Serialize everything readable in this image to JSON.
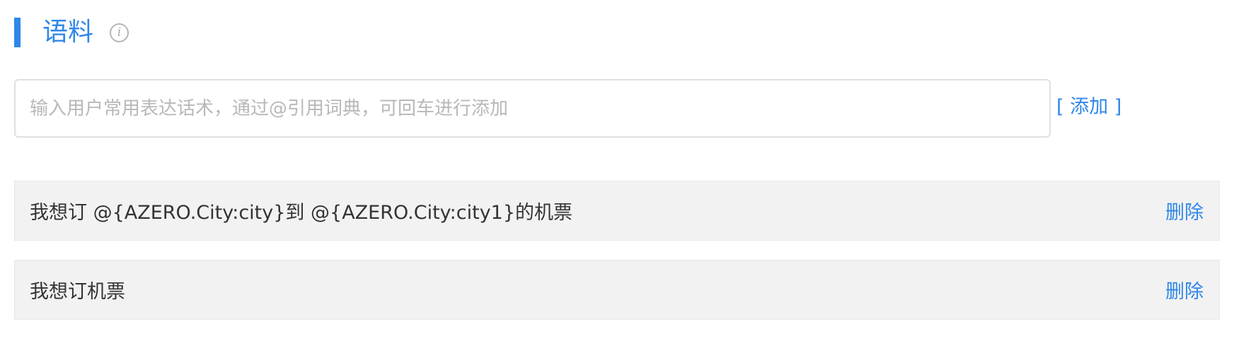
{
  "section": {
    "title": "语料",
    "info_icon_glyph": "i",
    "icon": "info-icon"
  },
  "input": {
    "value": "",
    "placeholder": "输入用户常用表达话术，通过@引用词典，可回车进行添加"
  },
  "add_label": "[ 添加 ]",
  "corpus_items": [
    {
      "text": "我想订 @{AZERO.City:city}到 @{AZERO.City:city1}的机票",
      "delete_label": "删除"
    },
    {
      "text": "我想订机票",
      "delete_label": "删除"
    }
  ],
  "colors": {
    "accent": "#2f87e8",
    "row_background": "#f2f2f2"
  }
}
